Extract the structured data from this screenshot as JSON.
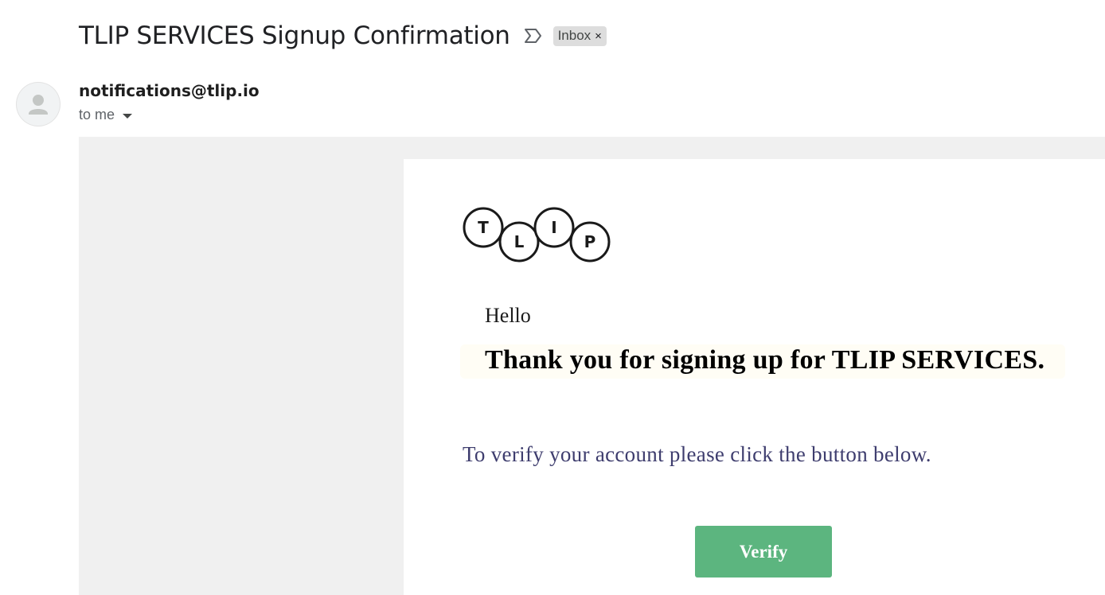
{
  "email": {
    "subject": "TLIP SERVICES Signup Confirmation",
    "importance_icon": "importance-marker-icon",
    "label": {
      "text": "Inbox",
      "remove": "×"
    },
    "sender": "notifications@tlip.io",
    "recipient": "to me"
  },
  "body": {
    "logo": {
      "letters": [
        "T",
        "L",
        "I",
        "P"
      ],
      "brand": "TLIP"
    },
    "greeting": "Hello",
    "thanks": "Thank you for signing up for TLIP SERVICES.",
    "instruction": "To verify your account please click the button below.",
    "verify_button": "Verify"
  },
  "colors": {
    "background_panel": "#f0f0f0",
    "button": "#5cb57f",
    "instruction_text": "#3e3d6e",
    "highlight_box": "#fffdf5"
  }
}
